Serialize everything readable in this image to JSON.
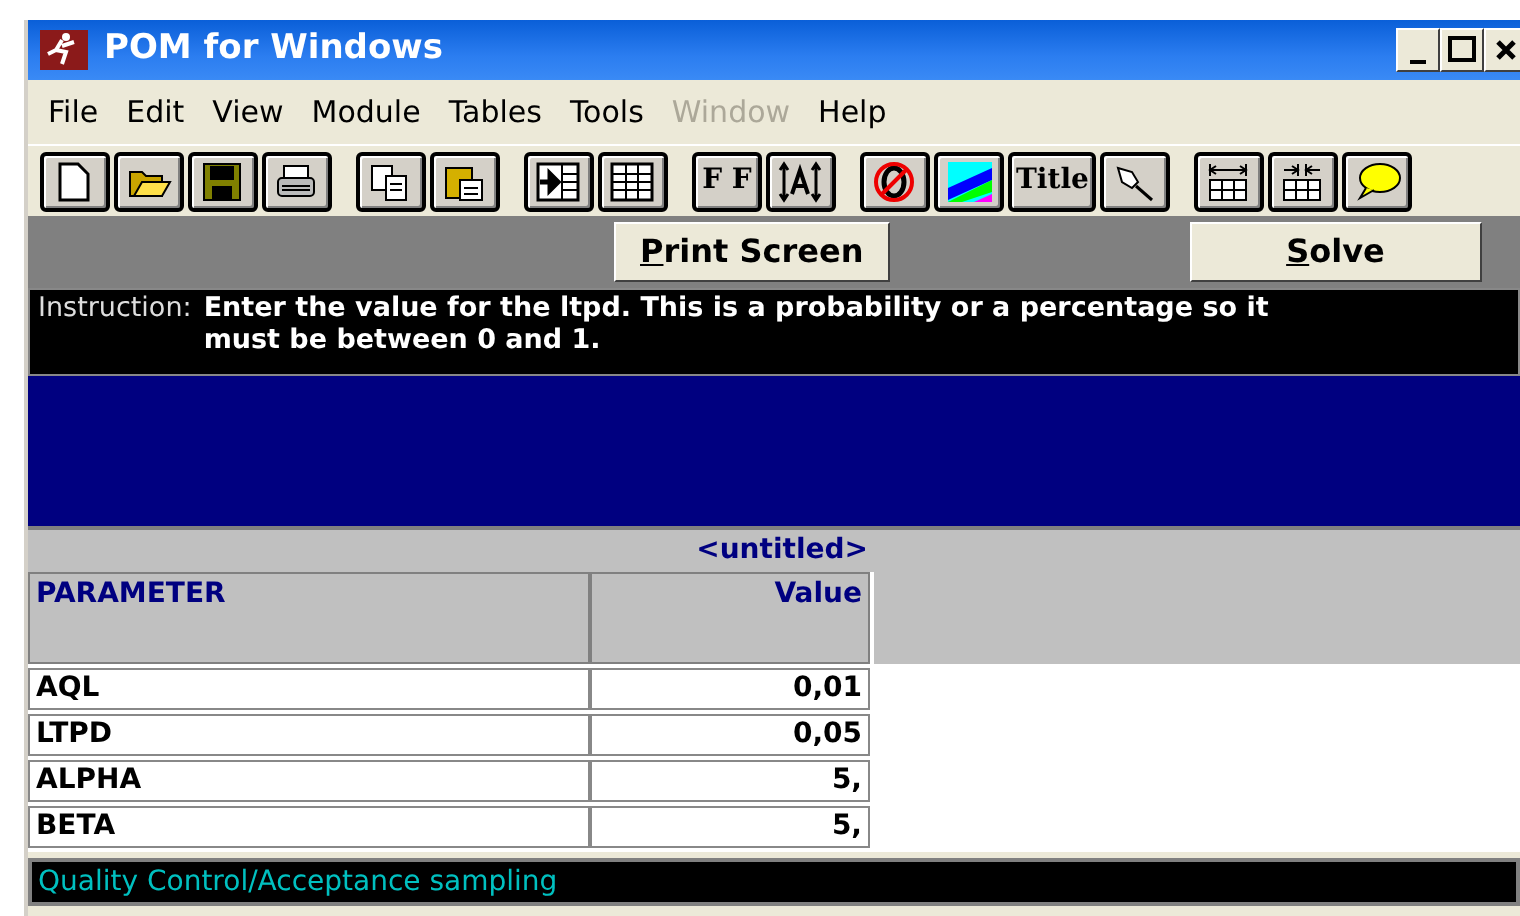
{
  "window": {
    "title": "POM for Windows"
  },
  "menu": [
    {
      "label": "File",
      "disabled": false
    },
    {
      "label": "Edit",
      "disabled": false
    },
    {
      "label": "View",
      "disabled": false
    },
    {
      "label": "Module",
      "disabled": false
    },
    {
      "label": "Tables",
      "disabled": false
    },
    {
      "label": "Tools",
      "disabled": false
    },
    {
      "label": "Window",
      "disabled": true
    },
    {
      "label": "Help",
      "disabled": false
    }
  ],
  "toolbar": [
    {
      "kind": "new"
    },
    {
      "kind": "open"
    },
    {
      "kind": "save"
    },
    {
      "kind": "print"
    },
    {
      "kind": "sep"
    },
    {
      "kind": "copy"
    },
    {
      "kind": "paste"
    },
    {
      "kind": "sep"
    },
    {
      "kind": "gridarrow"
    },
    {
      "kind": "grid"
    },
    {
      "kind": "sep"
    },
    {
      "kind": "text",
      "label": "F F"
    },
    {
      "kind": "fontsize"
    },
    {
      "kind": "sep"
    },
    {
      "kind": "nozero"
    },
    {
      "kind": "colors"
    },
    {
      "kind": "text",
      "label": "Title"
    },
    {
      "kind": "pin"
    },
    {
      "kind": "sep"
    },
    {
      "kind": "widen"
    },
    {
      "kind": "narrow"
    },
    {
      "kind": "bubble"
    }
  ],
  "actions": {
    "print_button": "Print Screen",
    "solve_button": "Solve"
  },
  "instruction": {
    "label": "Instruction:",
    "text": "Enter the value for the ltpd. This is a probability or a percentage so it must be between 0 and 1."
  },
  "table": {
    "title": "<untitled>",
    "columns": [
      "PARAMETER",
      "Value"
    ],
    "rows": [
      [
        "AQL",
        "0,01"
      ],
      [
        "LTPD",
        "0,05"
      ],
      [
        "ALPHA",
        "5,"
      ],
      [
        "BETA",
        "5,"
      ]
    ]
  },
  "status_bar": "Quality Control/Acceptance sampling"
}
